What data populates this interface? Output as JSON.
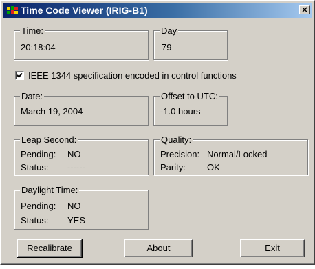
{
  "window": {
    "title": "Time Code Viewer (IRIG-B1)",
    "close_glyph": "×"
  },
  "time": {
    "label": "Time:",
    "value": "20:18:04"
  },
  "day": {
    "label": "Day",
    "value": "79"
  },
  "ieee_option": {
    "checked": true,
    "label": "IEEE 1344 specification encoded in control functions"
  },
  "date": {
    "label": "Date:",
    "value": "March 19, 2004"
  },
  "offset": {
    "label": "Offset to UTC:",
    "value": "-1.0 hours"
  },
  "leap_second": {
    "label": "Leap Second:",
    "pending_label": "Pending:",
    "pending_value": "NO",
    "status_label": "Status:",
    "status_value": "------"
  },
  "quality": {
    "label": "Quality:",
    "precision_label": "Precision:",
    "precision_value": "Normal/Locked",
    "parity_label": "Parity:",
    "parity_value": "OK"
  },
  "daylight_time": {
    "label": "Daylight Time:",
    "pending_label": "Pending:",
    "pending_value": "NO",
    "status_label": "Status:",
    "status_value": "YES"
  },
  "buttons": {
    "recalibrate": "Recalibrate",
    "about": "About",
    "exit": "Exit"
  },
  "colors": {
    "titlebar_start": "#0a246a",
    "titlebar_end": "#a6caf0",
    "dialog_face": "#d4d0c8"
  },
  "icons": {
    "app": "app-icon",
    "close": "close-icon",
    "check": "checkmark-icon"
  }
}
